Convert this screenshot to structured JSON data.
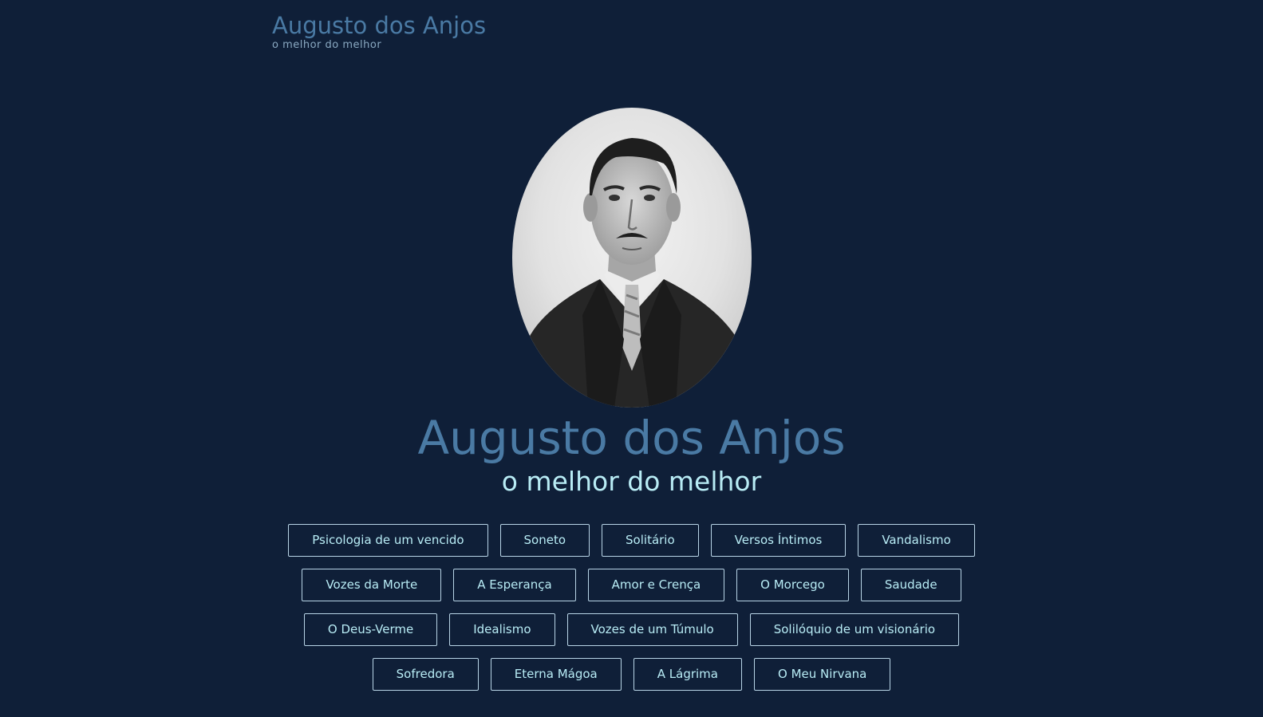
{
  "header": {
    "title": "Augusto dos Anjos",
    "subtitle": "o melhor do melhor"
  },
  "hero": {
    "title": "Augusto dos Anjos",
    "subtitle": "o melhor do melhor"
  },
  "poems": [
    [
      "Psicologia de um vencido",
      "Soneto",
      "Solitário",
      "Versos Íntimos",
      "Vandalismo"
    ],
    [
      "Vozes da Morte",
      "A Esperança",
      "Amor e Crença",
      "O Morcego",
      "Saudade"
    ],
    [
      "O Deus-Verme",
      "Idealismo",
      "Vozes de um Túmulo",
      "Solilóquio de um visionário"
    ],
    [
      "Sofredora",
      "Eterna Mágoa",
      "A Lágrima",
      "O Meu Nirvana"
    ]
  ],
  "colors": {
    "background": "#0f1f38",
    "title_blue": "#4a7aa4",
    "accent_cyan": "#b8ecf5",
    "button_border": "#b8d4e6"
  }
}
